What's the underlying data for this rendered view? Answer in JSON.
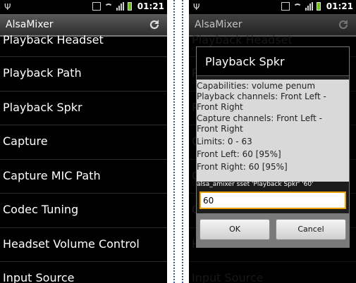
{
  "status": {
    "time": "01:21"
  },
  "app": {
    "title": "AlsaMixer"
  },
  "controls": [
    "Playback Headset",
    "Playback Path",
    "Playback Spkr",
    "Capture",
    "Capture MIC Path",
    "Codec Tuning",
    "Headset Volume Control",
    "Input Source"
  ],
  "dialog": {
    "title": "Playback Spkr",
    "lines": [
      " Capabilities: volume penum",
      " Playback channels: Front Left -",
      "Front Right",
      " Capture channels: Front Left -",
      "Front Right",
      " Limits: 0 - 63",
      " Front Left: 60 [95%]",
      " Front Right: 60 [95%]"
    ],
    "command": "alsa_amixer sset 'Playback Spkr' '60'",
    "value": "60",
    "ok_label": "OK",
    "cancel_label": "Cancel"
  },
  "icons": {
    "usb": "usb-icon",
    "vibrate": "vibrate-icon",
    "wifi": "wifi-icon",
    "signal": "signal-icon",
    "battery": "battery-icon",
    "refresh": "refresh-icon"
  },
  "colors": {
    "battery": "#6fc21c",
    "input_focus": "#e9a000",
    "dialog_body": "#d9d9d9"
  }
}
